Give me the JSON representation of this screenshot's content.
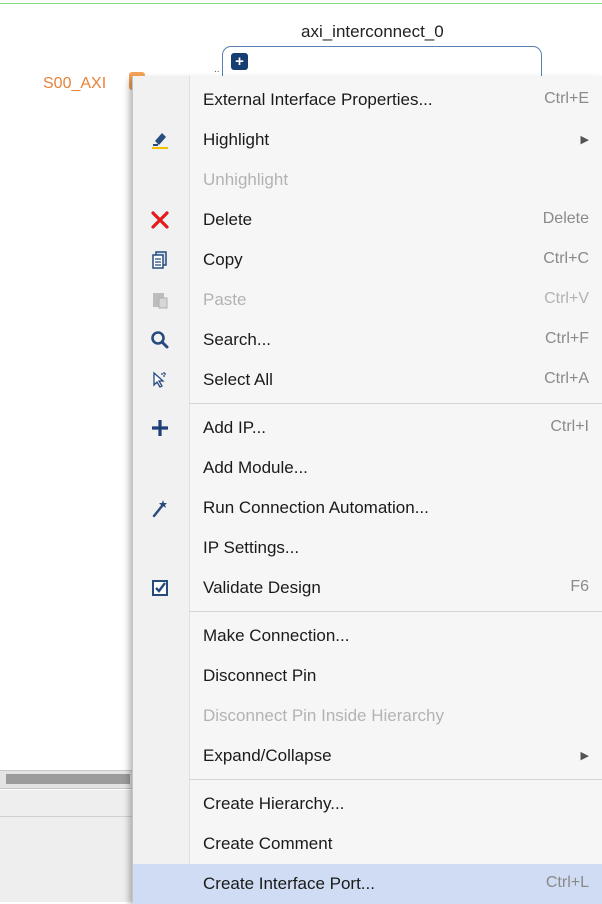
{
  "canvas": {
    "block_title": "axi_interconnect_0",
    "port_label": "S00_AXI",
    "expand_symbol": "+",
    "block_dots": "..",
    "colors": {
      "port": "#e8823a",
      "selection": "#cfdcf3"
    }
  },
  "menu": {
    "items": [
      {
        "label": "External Interface Properties...",
        "shortcut": "Ctrl+E",
        "icon": "none"
      },
      {
        "label": "Highlight",
        "shortcut": "",
        "submenu": true,
        "icon": "highlight-icon"
      },
      {
        "label": "Unhighlight",
        "shortcut": "",
        "disabled": true,
        "icon": "none"
      },
      {
        "label": "Delete",
        "shortcut": "Delete",
        "icon": "delete-icon"
      },
      {
        "label": "Copy",
        "shortcut": "Ctrl+C",
        "icon": "copy-icon"
      },
      {
        "label": "Paste",
        "shortcut": "Ctrl+V",
        "disabled": true,
        "icon": "paste-icon"
      },
      {
        "label": "Search...",
        "shortcut": "Ctrl+F",
        "icon": "search-icon"
      },
      {
        "label": "Select All",
        "shortcut": "Ctrl+A",
        "icon": "select-all-icon"
      },
      {
        "label": "Add IP...",
        "shortcut": "Ctrl+I",
        "icon": "plus-icon"
      },
      {
        "label": "Add Module...",
        "shortcut": "",
        "icon": "none"
      },
      {
        "label": "Run Connection Automation...",
        "shortcut": "",
        "icon": "wand-icon"
      },
      {
        "label": "IP Settings...",
        "shortcut": "",
        "icon": "none"
      },
      {
        "label": "Validate Design",
        "shortcut": "F6",
        "icon": "validate-icon"
      },
      {
        "label": "Make Connection...",
        "shortcut": "",
        "icon": "none"
      },
      {
        "label": "Disconnect Pin",
        "shortcut": "",
        "icon": "none"
      },
      {
        "label": "Disconnect Pin Inside Hierarchy",
        "shortcut": "",
        "disabled": true,
        "icon": "none"
      },
      {
        "label": "Expand/Collapse",
        "shortcut": "",
        "submenu": true,
        "icon": "none"
      },
      {
        "label": "Create Hierarchy...",
        "shortcut": "",
        "icon": "none"
      },
      {
        "label": "Create Comment",
        "shortcut": "",
        "icon": "none"
      },
      {
        "label": "Create Interface Port...",
        "shortcut": "Ctrl+L",
        "selected": true,
        "icon": "none"
      }
    ]
  }
}
